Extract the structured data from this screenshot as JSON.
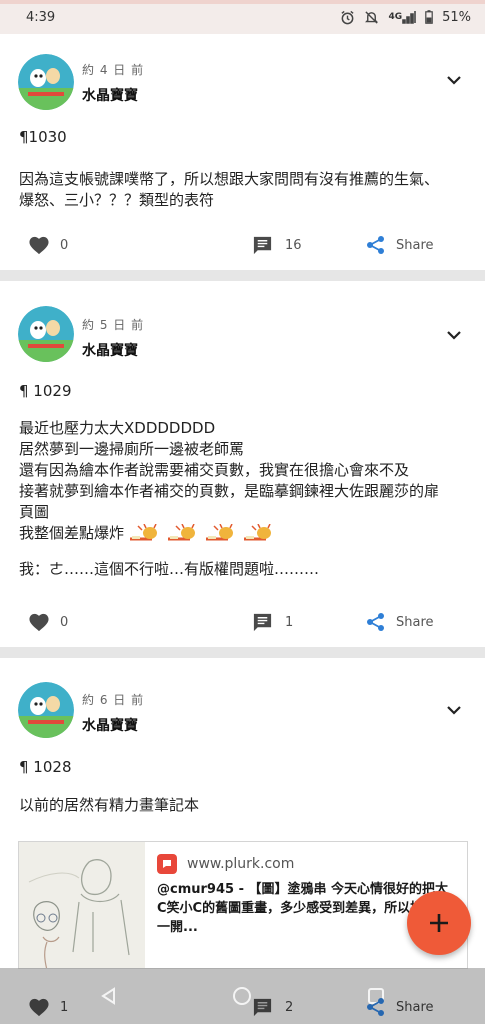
{
  "status_bar": {
    "time": "4:39",
    "network": "4G",
    "battery": "51%",
    "icons": [
      "alarm-icon",
      "mute-icon",
      "signal-icon",
      "battery-icon"
    ]
  },
  "posts": [
    {
      "time": "約 4 日 前",
      "author": "水晶寶寶",
      "lines": [
        "¶1030",
        "",
        "因為這支帳號課噗幣了，所以想跟大家問問有沒有推薦的生氣、",
        "爆怒、三小？？？類型的表符"
      ],
      "likes": "0",
      "comments": "16",
      "share_label": "Share"
    },
    {
      "time": "約 5 日 前",
      "author": "水晶寶寶",
      "lines": [
        "¶ 1029",
        "",
        "最近也壓力太大XDDDDDDD",
        "居然夢到一邊掃廁所一邊被老師罵",
        "還有因為繪本作者說需要補交頁數，我實在很擔心會來不及",
        "接著就夢到繪本作者補交的頁數，是臨摹鋼鍊裡大佐跟麗莎的扉",
        "頁圖",
        "我整個差點爆炸",
        "",
        "我：ㄜ……這個不行啦…有版權問題啦………"
      ],
      "likes": "0",
      "comments": "1",
      "share_label": "Share"
    },
    {
      "time": "約 6 日 前",
      "author": "水晶寶寶",
      "lines": [
        "¶ 1028",
        "",
        "以前的居然有精力畫筆記本"
      ],
      "likes": "1",
      "comments": "2",
      "share_label": "Share",
      "link": {
        "site": "www.plurk.com",
        "description": "@cmur945 - 【圖】塗鴉串 今天心情很好的把大C笑小C的舊圖重畫，多少感受到差異，所以把從大一開..."
      }
    }
  ],
  "colors": {
    "accent": "#ef5a38",
    "share_blue": "#2f7fd6",
    "divider": "#e6e6e6"
  }
}
